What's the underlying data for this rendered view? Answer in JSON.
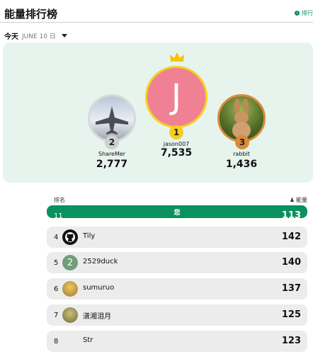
{
  "header": {
    "title": "能量排行榜",
    "help_label": "排行"
  },
  "date": {
    "today": "今天",
    "date": "JUNE 10 日"
  },
  "podium": [
    {
      "rank": "2",
      "name": "ShareMer",
      "score": "2,777"
    },
    {
      "rank": "1",
      "name": "jason007",
      "score": "7,535",
      "initial": "J"
    },
    {
      "rank": "3",
      "name": "rabbit",
      "score": "1,436"
    }
  ],
  "list": {
    "rank_header": "排名",
    "energy_header": "能量",
    "me": {
      "rank": "11",
      "label": "您",
      "score": "113"
    },
    "rows": [
      {
        "rank": "4",
        "name": "Tily",
        "score": "142"
      },
      {
        "rank": "5",
        "name": "2529duck",
        "score": "140",
        "initial": "2"
      },
      {
        "rank": "6",
        "name": "sumuruo",
        "score": "137"
      },
      {
        "rank": "7",
        "name": "潇湘泪月",
        "score": "125"
      },
      {
        "rank": "8",
        "name": "Str",
        "score": "123"
      }
    ]
  },
  "colors": {
    "accent": "#0a9160",
    "gold": "#f5d020",
    "bronze": "#d98b3a",
    "silver": "#cfcfcf",
    "podium_bg": "#e7f4ee"
  }
}
